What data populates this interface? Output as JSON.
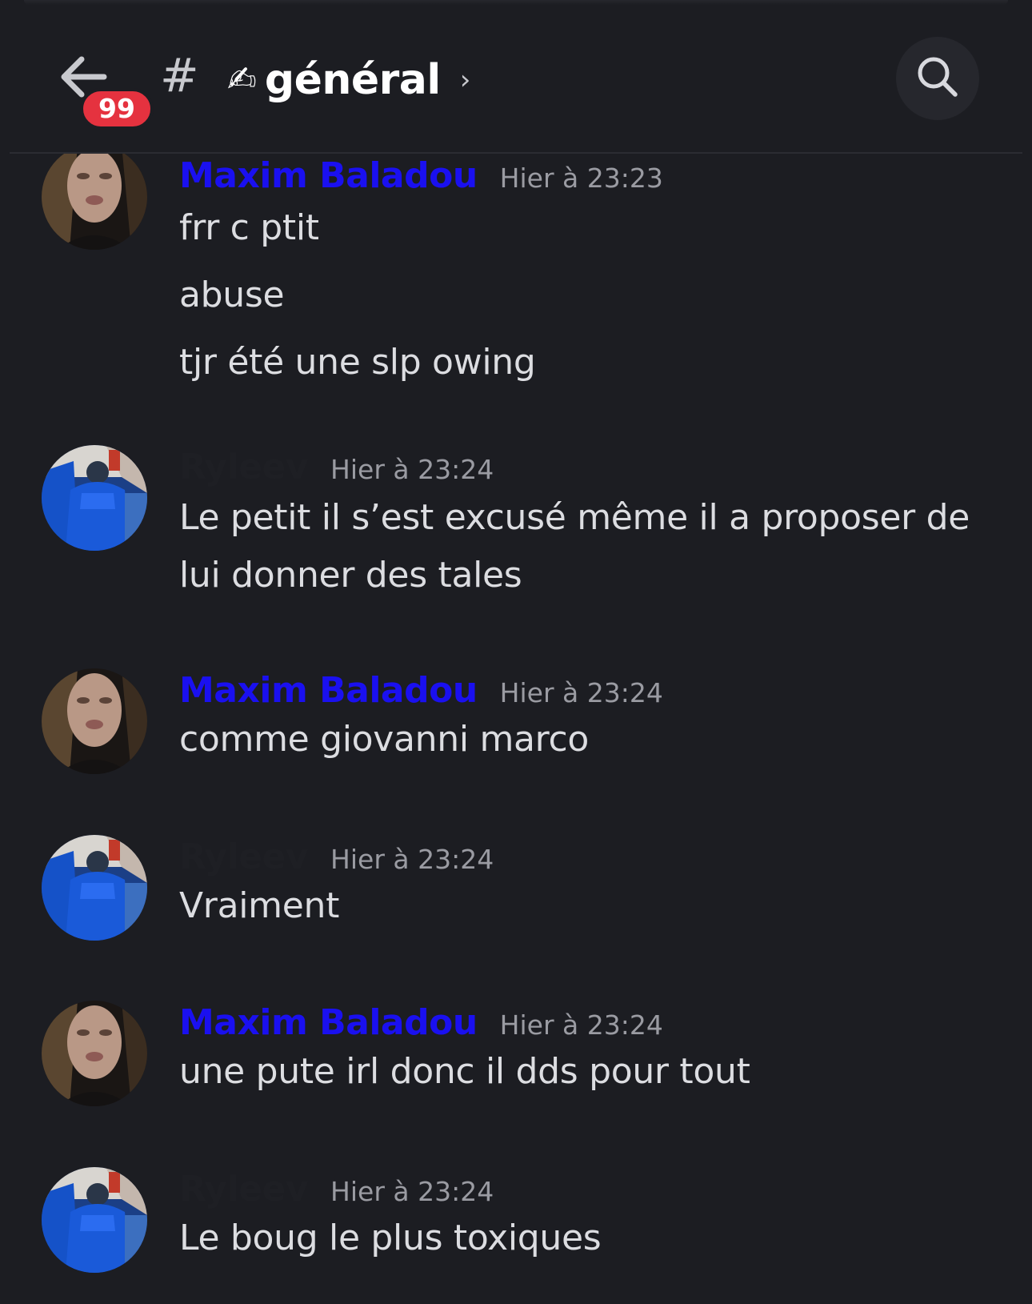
{
  "header": {
    "unread_count": "99",
    "channel_hash": "#",
    "channel_emoji": "✍",
    "channel_name": "général",
    "chevron": "›"
  },
  "colors": {
    "background": "#1c1d22",
    "maxim_name": "#1a10f0",
    "ryleev_name": "#1e1f24",
    "badge": "#e5323f",
    "message_text": "#dcdde1",
    "timestamp": "#9a9ba2"
  },
  "icons": {
    "back": "back-arrow-icon",
    "search": "search-icon"
  },
  "messages": [
    {
      "author": "Maxim Baladou",
      "time": "Hier à 23:23",
      "lines": [
        "frr c ptit",
        "abuse",
        "tjr été une slp owing"
      ]
    },
    {
      "author": "Ryleev",
      "time": "Hier à 23:24",
      "lines": [
        "Le petit il s’est excusé même il a proposer de",
        "lui donner des tales"
      ]
    },
    {
      "author": "Maxim Baladou",
      "time": "Hier à 23:24",
      "lines": [
        "comme giovanni marco"
      ]
    },
    {
      "author": "Ryleev",
      "time": "Hier à 23:24",
      "lines": [
        "Vraiment"
      ]
    },
    {
      "author": "Maxim Baladou",
      "time": "Hier à 23:24",
      "lines": [
        "une pute irl donc il dds pour tout"
      ]
    },
    {
      "author": "Ryleev",
      "time": "Hier à 23:24",
      "lines": [
        "Le boug le plus toxiques"
      ]
    }
  ]
}
